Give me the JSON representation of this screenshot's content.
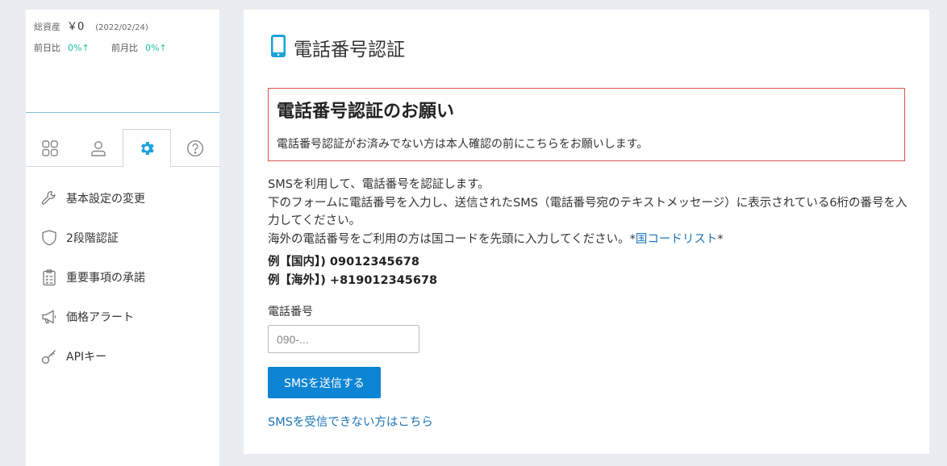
{
  "sidebar": {
    "assets": {
      "label": "総資産",
      "amount": "￥0",
      "date": "(2022/02/24)",
      "prev_day_label": "前日比",
      "prev_day_value": "0%↑",
      "prev_month_label": "前月比",
      "prev_month_value": "0%↑"
    },
    "tabs": [
      {
        "icon": "grid-icon",
        "active": false
      },
      {
        "icon": "user-icon",
        "active": false
      },
      {
        "icon": "gear-icon",
        "active": true
      },
      {
        "icon": "help-icon",
        "active": false
      }
    ],
    "menu": [
      {
        "label": "基本設定の変更",
        "icon": "wrench-icon"
      },
      {
        "label": "2段階認証",
        "icon": "shield-icon"
      },
      {
        "label": "重要事項の承諾",
        "icon": "clipboard-icon"
      },
      {
        "label": "価格アラート",
        "icon": "megaphone-icon"
      },
      {
        "label": "APIキー",
        "icon": "key-icon"
      }
    ]
  },
  "main": {
    "title": "電話番号認証",
    "notice": {
      "heading": "電話番号認証のお願い",
      "body": "電話番号認証がお済みでない方は本人確認の前にこちらをお願いします。"
    },
    "description": {
      "line1": "SMSを利用して、電話番号を認証します。",
      "line2": "下のフォームに電話番号を入力し、送信されたSMS（電話番号宛のテキストメッセージ）に表示されている6桁の番号を入力してください。",
      "line3_prefix": "海外の電話番号をご利用の方は国コードを先頭に入力してください。*",
      "line3_link": "国コードリスト",
      "line3_suffix": "*"
    },
    "examples": {
      "domestic": "例【国内】) 09012345678",
      "overseas": "例【海外】) +819012345678"
    },
    "phone_field": {
      "label": "電話番号",
      "placeholder": "090-...",
      "value": ""
    },
    "send_button": "SMSを送信する",
    "help_link": "SMSを受信できない方はこちら"
  },
  "colors": {
    "accent": "#0d84d4",
    "active_icon": "#1aa3d9",
    "positive": "#1ebea5",
    "notice_border": "#d9534f",
    "link": "#1a73b8"
  }
}
